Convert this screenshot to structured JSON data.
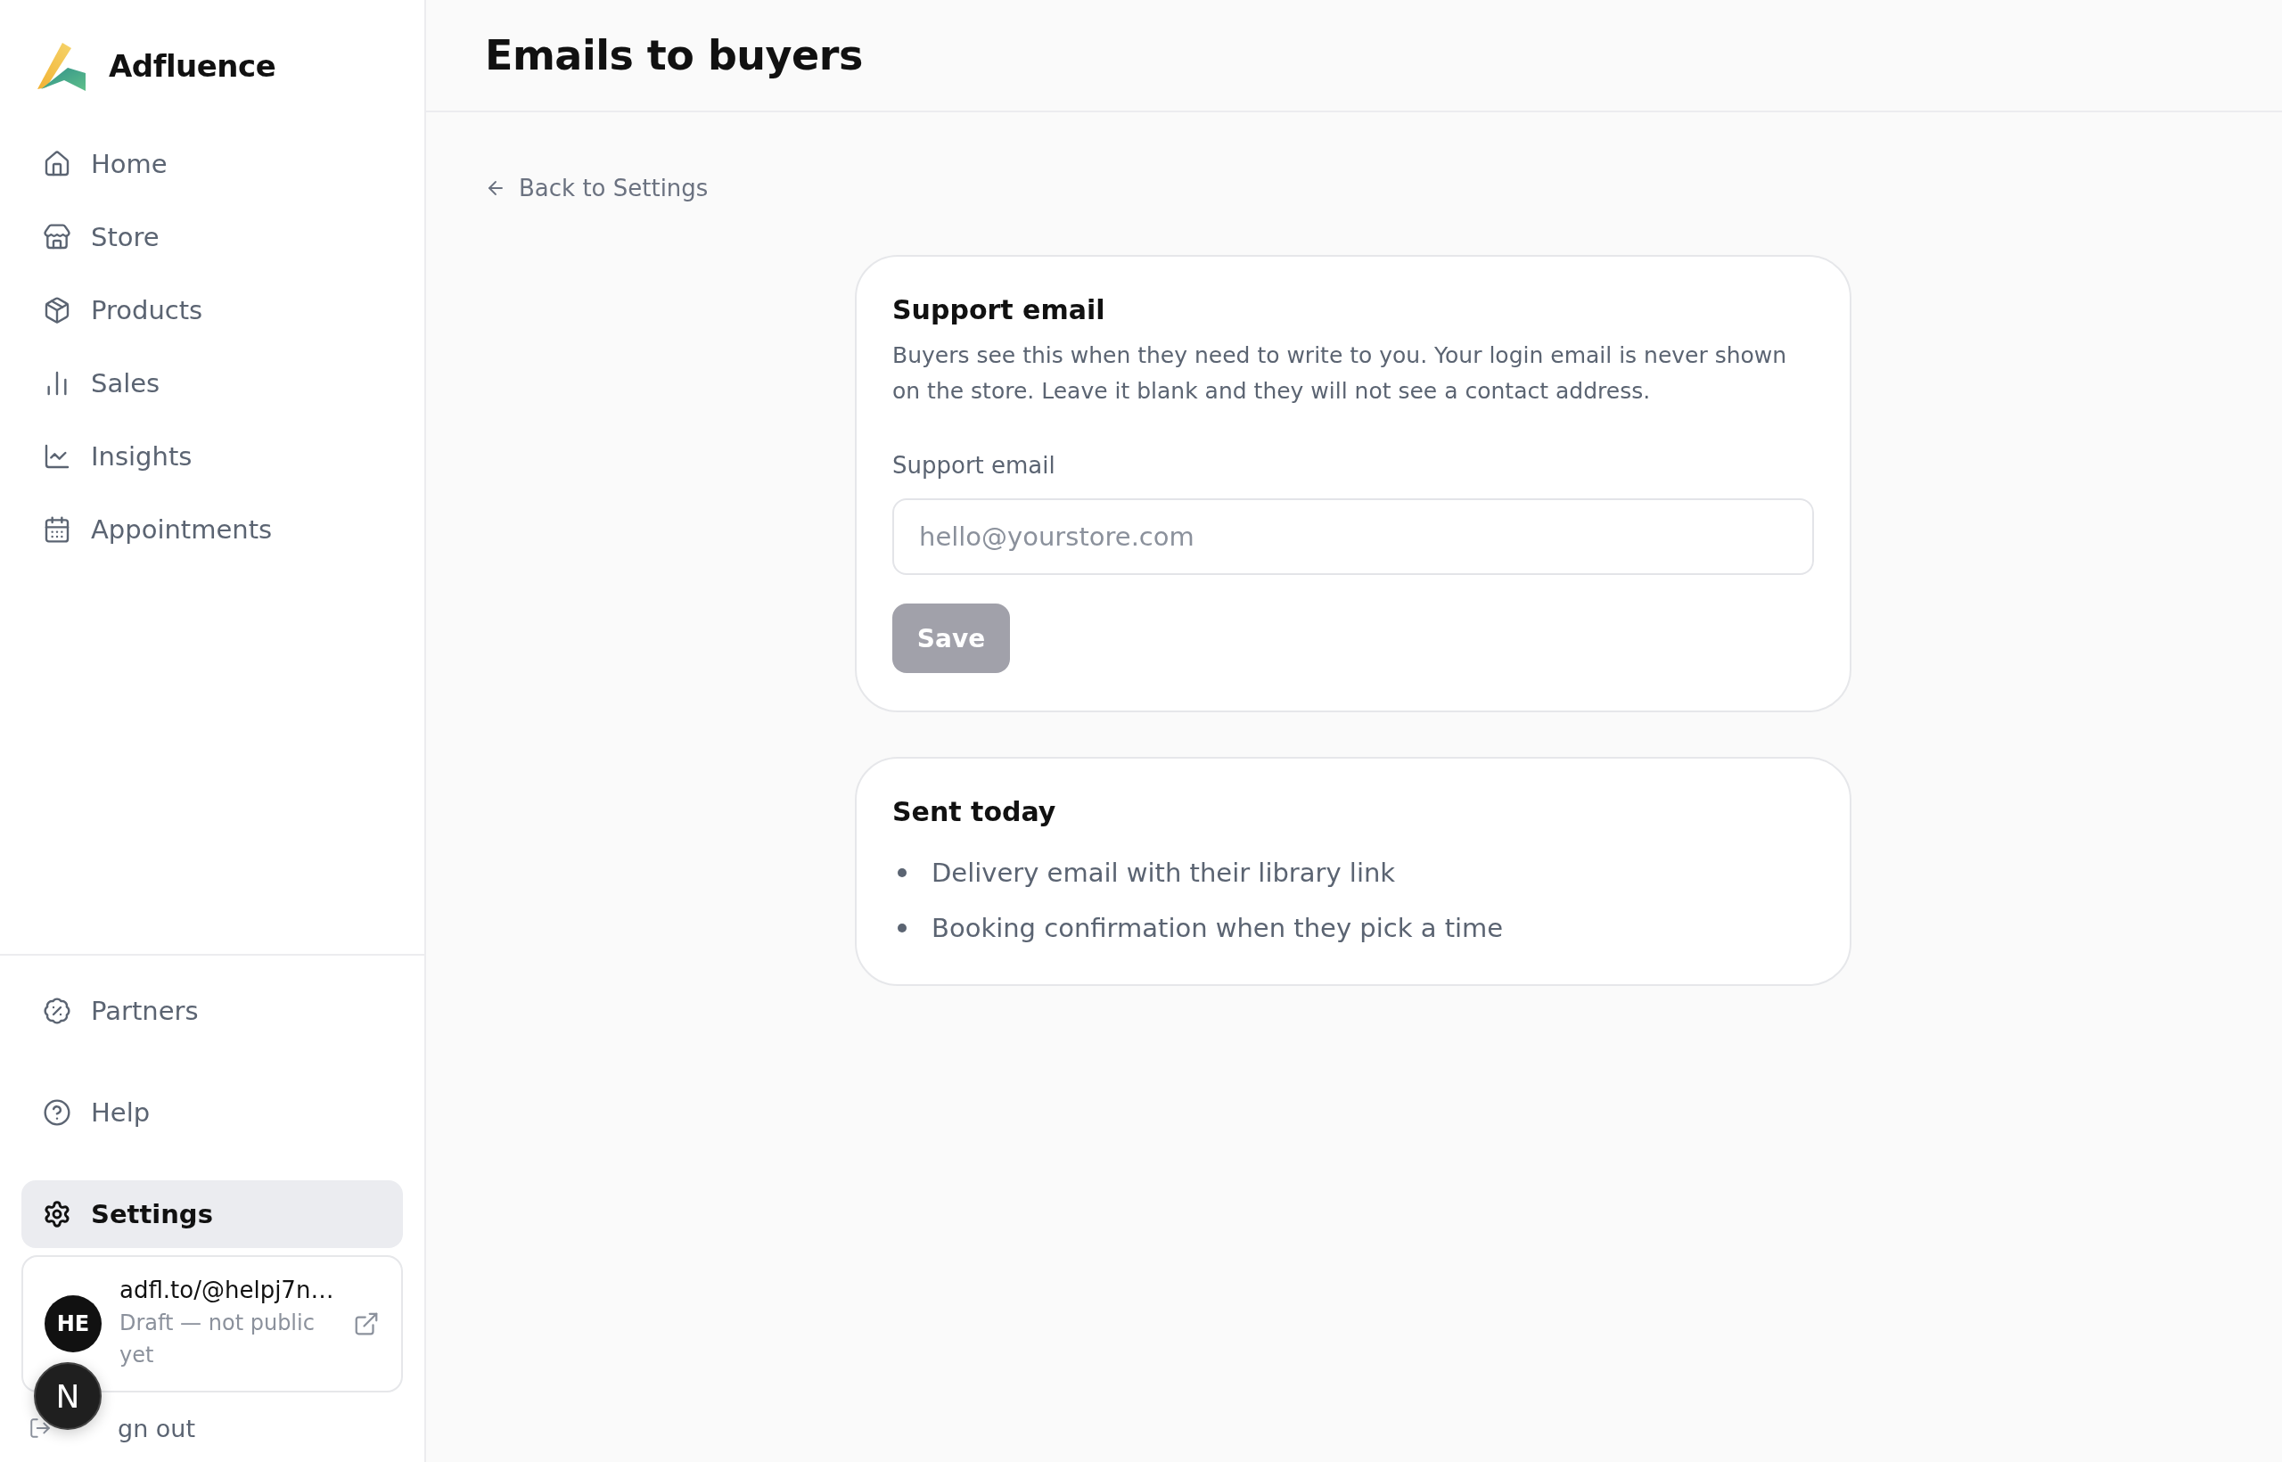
{
  "brand": {
    "name": "Adfluence"
  },
  "sidebar": {
    "items": [
      {
        "label": "Home",
        "selected": false
      },
      {
        "label": "Store",
        "selected": false
      },
      {
        "label": "Products",
        "selected": false
      },
      {
        "label": "Sales",
        "selected": false
      },
      {
        "label": "Insights",
        "selected": false
      },
      {
        "label": "Appointments",
        "selected": false
      }
    ],
    "footer_items": [
      {
        "label": "Partners",
        "selected": false
      },
      {
        "label": "Help",
        "selected": false
      },
      {
        "label": "Settings",
        "selected": true
      }
    ],
    "profile": {
      "initials": "HE",
      "url": "adfl.to/@helpj7n…",
      "status": "Draft — not public yet"
    },
    "sign_out": "gn out",
    "dev_badge": "N"
  },
  "header": {
    "title": "Emails to buyers"
  },
  "back_link": "Back to Settings",
  "support_card": {
    "title": "Support email",
    "description": "Buyers see this when they need to write to you. Your login email is never shown on the store. Leave it blank and they will not see a contact address.",
    "field_label": "Support email",
    "placeholder": "hello@yourstore.com",
    "save_button": {
      "label": "Save",
      "disabled": true
    }
  },
  "sent_card": {
    "title": "Sent today",
    "items": [
      "Delivery email with their library link",
      "Booking confirmation when they pick a time"
    ]
  }
}
